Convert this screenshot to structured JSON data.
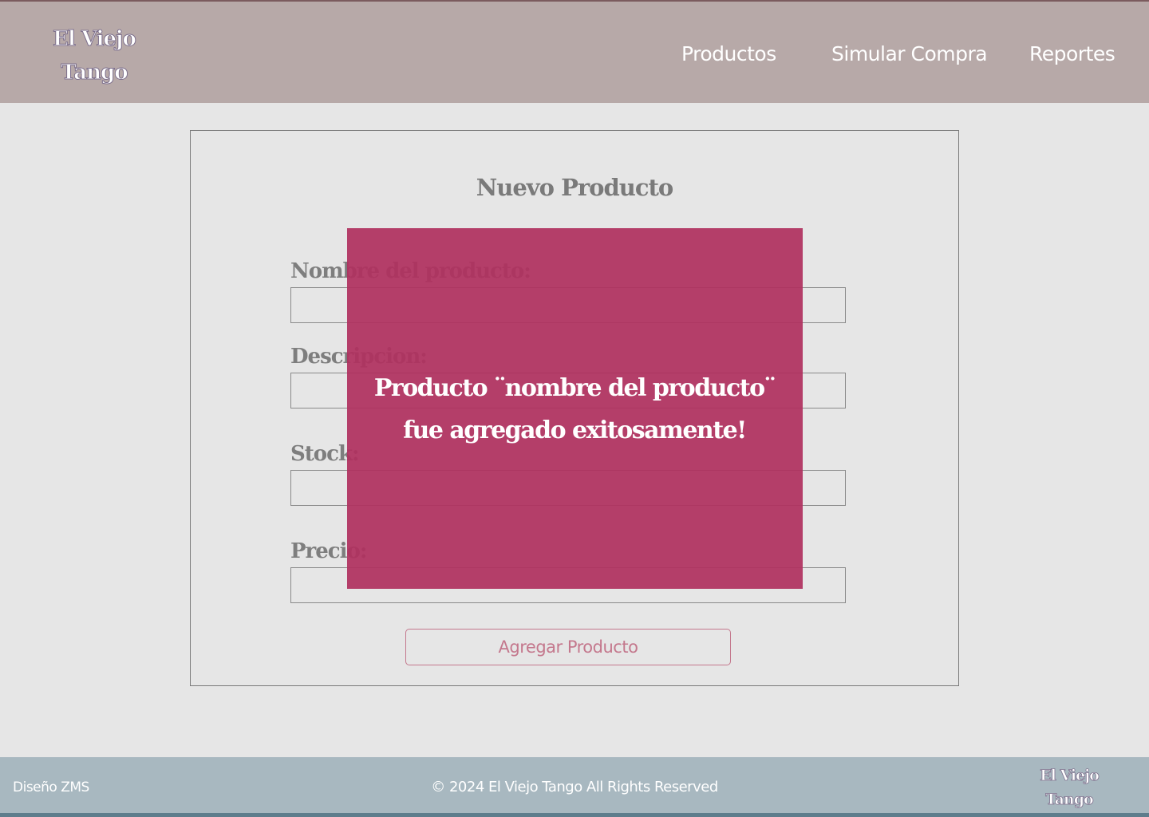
{
  "header": {
    "logo_line1": "El Viejo",
    "logo_line2": "Tango",
    "nav": {
      "products": "Productos",
      "simulate": "Simular Compra",
      "reports": "Reportes"
    }
  },
  "form": {
    "title": "Nuevo Producto",
    "name_label": "Nombre del producto:",
    "description_label": "Descripcion:",
    "stock_label": "Stock:",
    "price_label": "Precio:",
    "submit_label": "Agregar Producto"
  },
  "modal": {
    "line1": "Producto ¨nombre del producto¨",
    "line2": "fue agregado exitosamente!"
  },
  "footer": {
    "credit": "Diseño ZMS",
    "copyright": "© 2024  El Viejo Tango All Rights Reserved",
    "logo_line1": "El Viejo",
    "logo_line2": "Tango"
  },
  "colors": {
    "header_bg": "#b7a9a8",
    "page_bg": "#e6e6e6",
    "modal_bg": "#b0305e",
    "accent": "#c4788d",
    "footer_bg": "#a8b8c0"
  }
}
